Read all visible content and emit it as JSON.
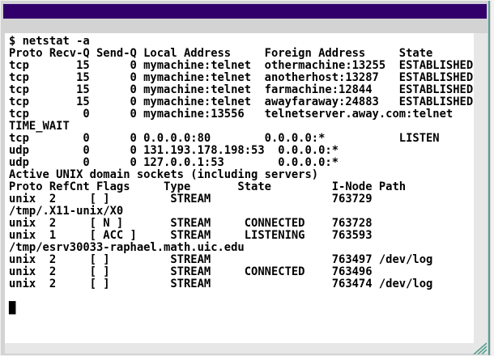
{
  "window": {
    "titlebar_color": "#32006a",
    "frame_color": "#d3d3d3",
    "strip_color": "#e7e7e7",
    "accent_color": "#579e91"
  },
  "terminal": {
    "background": "#ffffff",
    "text_color": "#000000",
    "lines": [
      "$ netstat -a",
      "Proto Recv-Q Send-Q Local Address     Foreign Address     State",
      "tcp       15      0 mymachine:telnet  othermachine:13255  ESTABLISHED",
      "tcp       15      0 mymachine:telnet  anotherhost:13287   ESTABLISHED",
      "tcp       15      0 mymachine:telnet  farmachine:12844    ESTABLISHED",
      "tcp       15      0 mymachine:telnet  awayfaraway:24883   ESTABLISHED",
      "tcp        0      0 mymachine:13556   telnetserver.away.com:telnet",
      "TIME_WAIT",
      "tcp        0      0 0.0.0.0:80        0.0.0.0:*           LISTEN",
      "udp        0      0 131.193.178.198:53  0.0.0.0:*",
      "udp        0      0 127.0.0.1:53        0.0.0.0:*",
      "Active UNIX domain sockets (including servers)",
      "Proto RefCnt Flags     Type       State         I-Node Path",
      "unix  2     [ ]         STREAM                  763729",
      "/tmp/.X11-unix/X0",
      "unix  2     [ N ]       STREAM     CONNECTED    763728",
      "unix  1     [ ACC ]     STREAM     LISTENING    763593",
      "/tmp/esrv30033-raphael.math.uic.edu",
      "unix  2     [ ]         STREAM                  763497 /dev/log",
      "unix  2     [ ]         STREAM     CONNECTED    763496",
      "unix  2     [ ]         STREAM                  763474 /dev/log",
      ""
    ],
    "cursor": "█"
  }
}
